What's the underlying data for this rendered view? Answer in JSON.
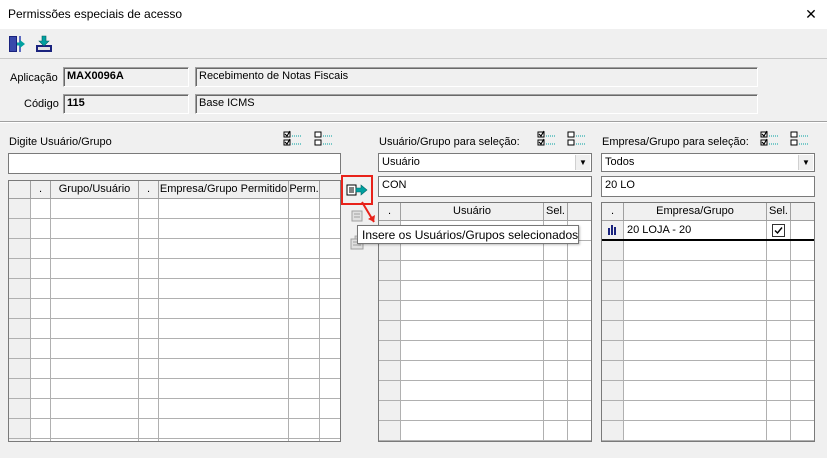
{
  "window": {
    "title": "Permissões especiais de acesso",
    "close_glyph": "✕"
  },
  "header": {
    "aplicacao_label": "Aplicação",
    "aplicacao_code": "MAX0096A",
    "aplicacao_desc": "Recebimento de Notas Fiscais",
    "codigo_label": "Código",
    "codigo_value": "115",
    "codigo_desc": "Base ICMS"
  },
  "left_panel": {
    "label": "Digite Usuário/Grupo",
    "input_value": "",
    "columns": [
      ".",
      "Grupo/Usuário",
      ".",
      "Empresa/Grupo Permitido",
      "Perm."
    ]
  },
  "middle_panel": {
    "label": "Usuário/Grupo para seleção:",
    "filter_selected": "Usuário",
    "search_value": "CON",
    "columns": [
      ".",
      "Usuário",
      "Sel."
    ]
  },
  "right_panel": {
    "label": "Empresa/Grupo para seleção:",
    "filter_selected": "Todos",
    "search_value": "20 LO",
    "columns": [
      ".",
      "Empresa/Grupo",
      "Sel."
    ],
    "rows": [
      {
        "name": "20 LOJA - 20",
        "selected": true
      }
    ]
  },
  "tooltip": {
    "text": "Insere os Usuários/Grupos selecionados"
  },
  "icons": {
    "exit": "exit-door-icon",
    "save": "save-download-icon",
    "check_all": "check-all-icon",
    "uncheck_all": "uncheck-all-icon",
    "insert": "insert-selected-icon",
    "remove": "remove-selected-icon",
    "remove_all": "remove-all-icon",
    "company": "company-building-icon"
  },
  "colors": {
    "highlight": "#e8221a",
    "icon_teal": "#00a0a0"
  }
}
